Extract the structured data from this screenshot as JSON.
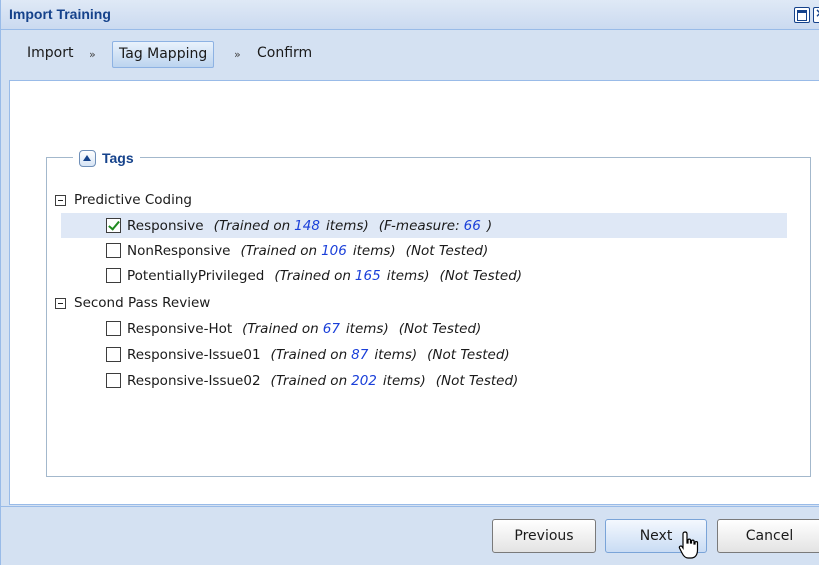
{
  "window": {
    "title": "Import Training"
  },
  "breadcrumb": {
    "steps": [
      "Import",
      "Tag Mapping",
      "Confirm"
    ],
    "separator": "»",
    "active_index": 1
  },
  "tags_panel": {
    "legend": "Tags",
    "groups": [
      {
        "name": "Predictive Coding",
        "items": [
          {
            "label": "Responsive",
            "trained_prefix": "(Trained on",
            "count": "148",
            "trained_suffix": "items)",
            "status": "(F-measure:",
            "status_value": "66",
            "status_suffix": ")",
            "checked": true,
            "selected": true
          },
          {
            "label": "NonResponsive",
            "trained_prefix": "(Trained on",
            "count": "106",
            "trained_suffix": "items)",
            "status": "(Not Tested)",
            "checked": false,
            "selected": false
          },
          {
            "label": "PotentiallyPrivileged",
            "trained_prefix": "(Trained on",
            "count": "165",
            "trained_suffix": "items)",
            "status": "(Not Tested)",
            "checked": false,
            "selected": false
          }
        ]
      },
      {
        "name": "Second Pass Review",
        "items": [
          {
            "label": "Responsive-Hot",
            "trained_prefix": "(Trained on",
            "count": "67",
            "trained_suffix": "items)",
            "status": "(Not Tested)",
            "checked": false,
            "selected": false
          },
          {
            "label": "Responsive-Issue01",
            "trained_prefix": "(Trained on",
            "count": "87",
            "trained_suffix": "items)",
            "status": "(Not Tested)",
            "checked": false,
            "selected": false
          },
          {
            "label": "Responsive-Issue02",
            "trained_prefix": "(Trained on",
            "count": "202",
            "trained_suffix": "items)",
            "status": "(Not Tested)",
            "checked": false,
            "selected": false
          }
        ]
      }
    ]
  },
  "footer": {
    "previous_label": "Previous",
    "next_label": "Next",
    "cancel_label": "Cancel"
  },
  "colors": {
    "accent": "#15428b",
    "count_blue": "#1a3fd9",
    "selected_row": "#dfe8f6",
    "panel_bg": "#d4e1f2"
  }
}
